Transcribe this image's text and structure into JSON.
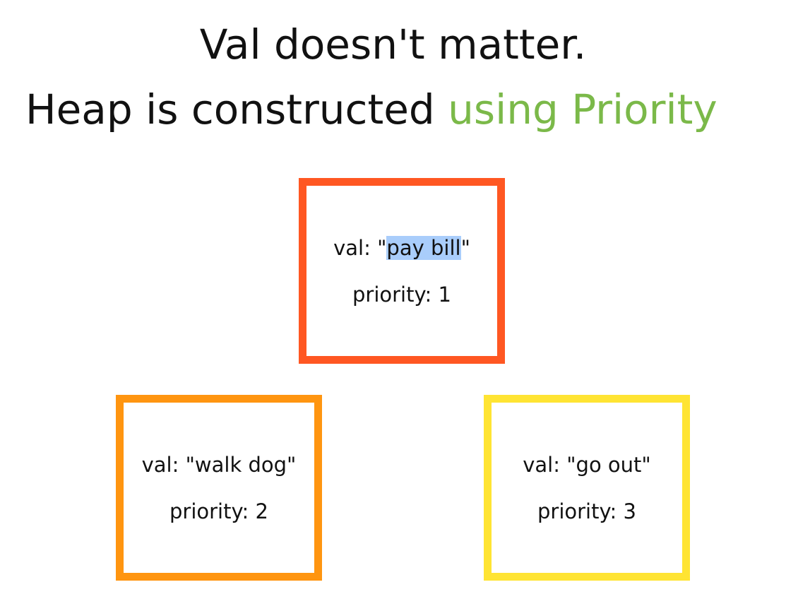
{
  "heading": {
    "line1": "Val doesn't matter.",
    "line2_plain": "Heap is constructed ",
    "line2_accent": "using Priority"
  },
  "nodes": {
    "root": {
      "val_prefix": "val: \"",
      "val_selected": "pay bill",
      "val_suffix": "\"",
      "priority": "priority: 1",
      "border_color": "#ff5722"
    },
    "left": {
      "val": "val: \"walk dog\"",
      "priority": "priority: 2",
      "border_color": "#ff9510"
    },
    "right": {
      "val": "val: \"go out\"",
      "priority": "priority: 3",
      "border_color": "#ffe433"
    }
  },
  "colors": {
    "accent_text": "#7bb949",
    "selection_highlight": "#a9cdfb"
  }
}
